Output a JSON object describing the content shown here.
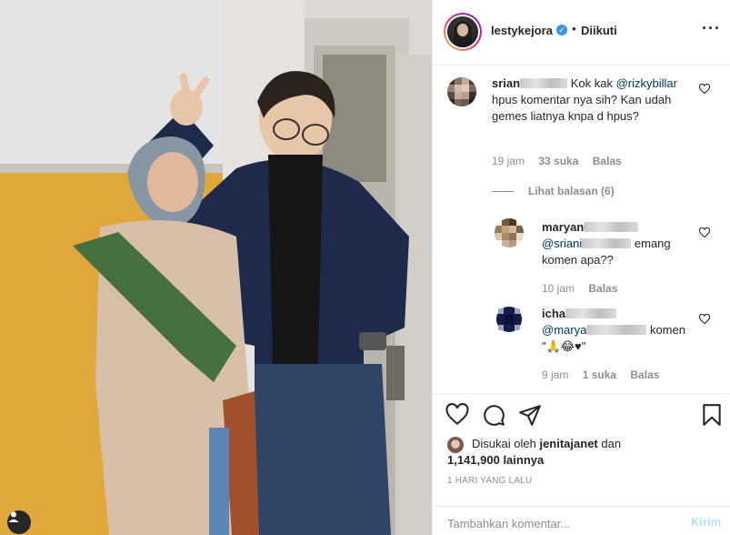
{
  "post": {
    "username": "lestykejora",
    "separator": "•",
    "follow_status": "Diikuti",
    "more_icon": "more-horizontal-icon"
  },
  "comments": [
    {
      "user_visible": "srian",
      "text_prefix": "Kok kak",
      "mention": "@rizkybillar",
      "text_rest": "hpus komentar nya sih? Kan udah gemes liatnya knpa d hpus?",
      "time": "19 jam",
      "likes": "33 suka",
      "reply": "Balas",
      "view_replies": "Lihat balasan (6)"
    }
  ],
  "replies": [
    {
      "user_visible": "maryan",
      "mention_visible": "@sriani",
      "text": "emang komen apa??",
      "time": "10 jam",
      "reply": "Balas"
    },
    {
      "user_visible": "icha",
      "mention_visible": "@marya",
      "text": "komen",
      "emoji_text": "\"🙏😂♥\"",
      "time": "9 jam",
      "likes": "1 suka",
      "reply": "Balas"
    }
  ],
  "likes": {
    "prefix": "Disukai oleh",
    "user": "jenitajanet",
    "connector": "dan",
    "count_text": "1,141,900 lainnya"
  },
  "time_ago": "1 HARI YANG LALU",
  "add_comment": {
    "placeholder": "Tambahkan komentar...",
    "post_label": "Kirim"
  },
  "colors": {
    "link": "#003569",
    "muted": "#8e8e8e",
    "verified": "#3897f0",
    "post_button": "#b2dffc"
  }
}
